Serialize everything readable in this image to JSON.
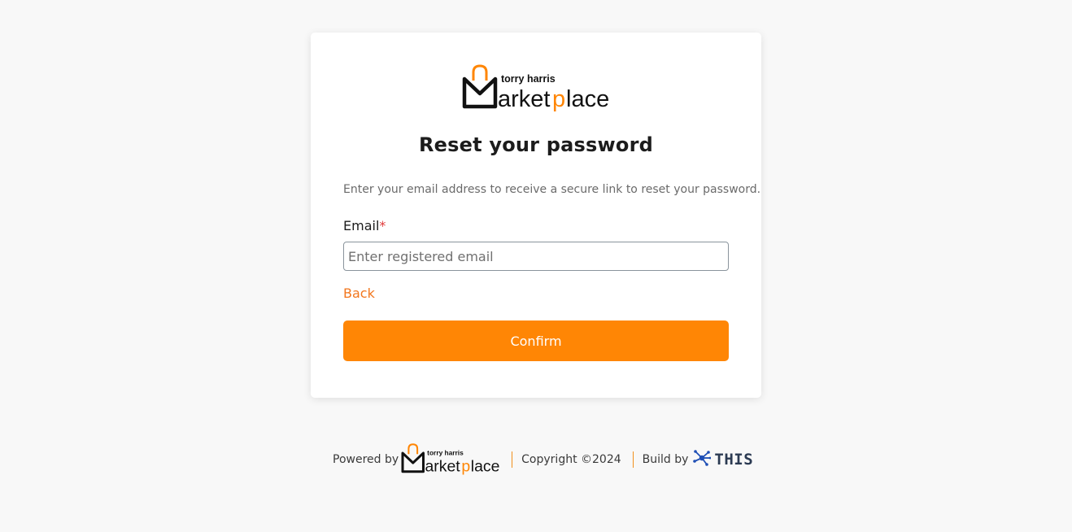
{
  "brand": {
    "logo_small_text": "torry harris",
    "logo_main_text": "arketplace",
    "logo_letter": "M",
    "accent_color": "#ff8605",
    "logo_dark_color": "#111111"
  },
  "form": {
    "title": "Reset your password",
    "subtitle": "Enter your email address to receive a secure link to reset your password.",
    "email_label": "Email",
    "required_mark": "*",
    "email_placeholder": "Enter registered email",
    "email_value": "",
    "back_label": "Back",
    "confirm_label": "Confirm"
  },
  "footer": {
    "powered_by": "Powered by",
    "copyright": "Copyright ©2024",
    "build_by": "Build by",
    "builder_name": "THIS",
    "builder_icon": "network-node-icon"
  }
}
